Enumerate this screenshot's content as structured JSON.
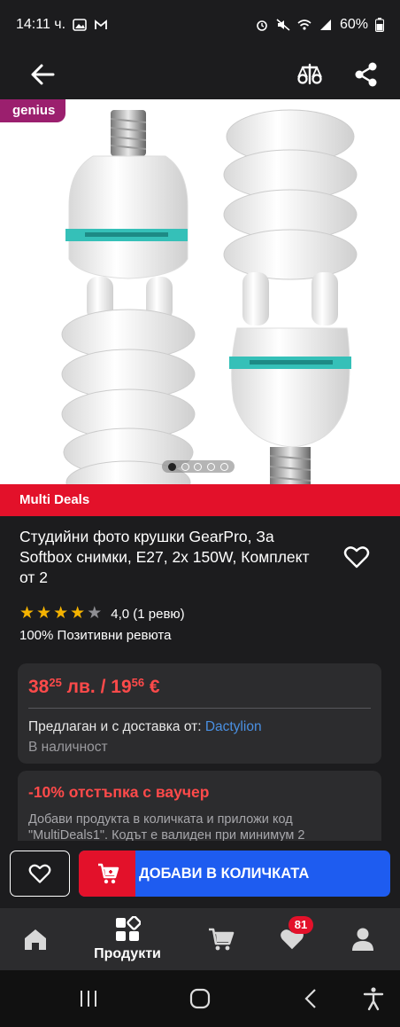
{
  "status_bar": {
    "time": "14:11 ч.",
    "battery": "60%"
  },
  "app_bar": {
    "icons": [
      "back-arrow-icon",
      "compare-scale-icon",
      "share-icon"
    ]
  },
  "hero": {
    "badge": "genius",
    "carousel_total": 5,
    "carousel_active": 1
  },
  "seller_banner": "Multi Deals",
  "product": {
    "title": "Студийни фото крушки GearPro, За Softbox снимки, E27, 2x 150W, Комплект от 2",
    "rating_stars": 4,
    "rating_text": "4,0 (1 ревю)",
    "positive_reviews": "100% Позитивни ревюта"
  },
  "price_card": {
    "price_bgn_main": "38",
    "price_bgn_cents": "25",
    "price_bgn_currency": " лв. / ",
    "price_eur_main": "19",
    "price_eur_cents": "56",
    "price_eur_currency": " €",
    "offered_label": "Предлаган и с доставка от: ",
    "seller_link": "Dactylion",
    "stock": "В наличност"
  },
  "voucher": {
    "title": "-10% отстъпка с ваучер",
    "text": "Добави продукта в количката и приложи код \"MultiDeals1\". Кодът е валиден при минимум 2"
  },
  "sticky": {
    "add_to_cart": "ДОБАВИ В КОЛИЧКАТА"
  },
  "bottom_nav": {
    "products_label": "Продукти",
    "favorites_badge": "81"
  },
  "colors": {
    "accent_red": "#e3112a",
    "accent_blue": "#1e5cf0",
    "price_red": "#ff4a4a",
    "link_blue": "#4a90e2",
    "genius_purple": "#9b1f6e"
  }
}
